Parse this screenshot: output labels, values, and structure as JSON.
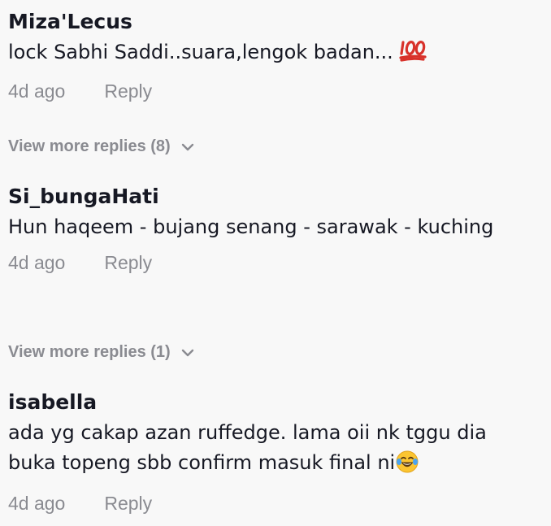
{
  "comments": [
    {
      "username": "Miza'Lecus",
      "text": "lock Sabhi Saddi..suara,lengok badan...",
      "emoji": "hundred-points-emoji",
      "time": "4d ago",
      "reply_label": "Reply"
    },
    {
      "username": "Si_bungaHati",
      "text": "Hun haqeem - bujang senang - sarawak - kuching",
      "time": "4d ago",
      "reply_label": "Reply"
    },
    {
      "username": "isabella",
      "text": "ada yg cakap azan ruffedge. lama oii nk tggu dia buka topeng sbb confirm masuk final ni",
      "emoji": "face-with-tears-of-joy-emoji",
      "time": "4d ago",
      "reply_label": "Reply"
    }
  ],
  "view_more": [
    {
      "label": "View more replies (8)",
      "icon": "chevron-down-icon"
    },
    {
      "label": "View more replies (1)",
      "icon": "chevron-down-icon"
    }
  ],
  "colors": {
    "background": "#f8f8f8",
    "primary_text": "#161823",
    "secondary_text": "#8a8b91"
  }
}
